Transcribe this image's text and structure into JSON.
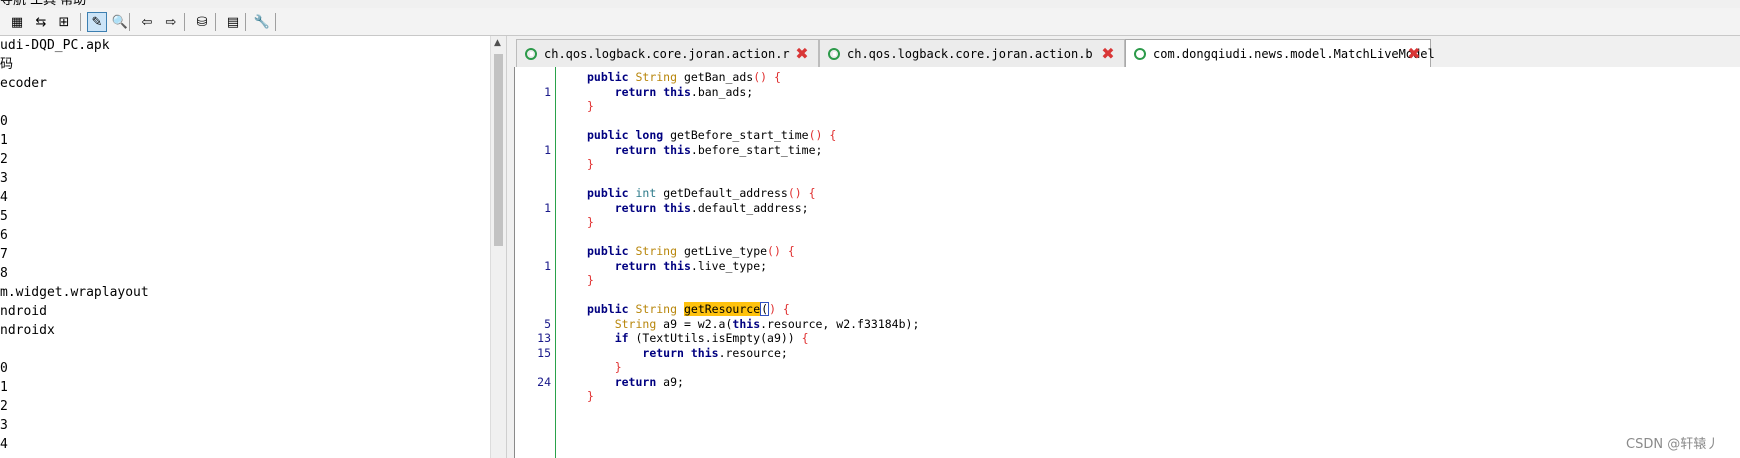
{
  "menubar": {
    "text": "导航 工具 帮助"
  },
  "toolbar": {
    "buttons": [
      {
        "name": "save-all",
        "glyph": "▦"
      },
      {
        "name": "sync-tree",
        "glyph": "⇆"
      },
      {
        "name": "flatten-packages",
        "glyph": "⊞"
      },
      {
        "name": "deobfuscation",
        "glyph": "✎"
      },
      {
        "name": "search",
        "glyph": "🔍"
      },
      {
        "name": "back",
        "glyph": "⇦"
      },
      {
        "name": "forward",
        "glyph": "⇨"
      },
      {
        "name": "decompile-all",
        "glyph": "⛁"
      },
      {
        "name": "log-viewer",
        "glyph": "▤"
      },
      {
        "name": "preferences",
        "glyph": "🔧"
      }
    ]
  },
  "tree": {
    "rows": [
      "udi-DQD_PC.apk",
      "码",
      "ecoder",
      "",
      "0",
      "1",
      "2",
      "3",
      "4",
      "5",
      "6",
      "7",
      "8",
      "m.widget.wraplayout",
      "ndroid",
      "ndroidx",
      "",
      "0",
      "1",
      "2",
      "3",
      "4"
    ]
  },
  "tabs": [
    {
      "label": "ch.qos.logback.core.joran.action.r",
      "active": false
    },
    {
      "label": "ch.qos.logback.core.joran.action.b",
      "active": false
    },
    {
      "label": "com.dongqiudi.news.model.MatchLiveModel",
      "active": true
    }
  ],
  "code": {
    "lines": [
      {
        "num": "",
        "tokens": [
          [
            "kw",
            "public"
          ],
          [
            "t",
            " "
          ],
          [
            "type",
            "String"
          ],
          [
            "t",
            " getBan_ads"
          ],
          [
            "br",
            "() {"
          ]
        ]
      },
      {
        "num": "1",
        "tokens": [
          [
            "t",
            "    "
          ],
          [
            "kw",
            "return"
          ],
          [
            "t",
            " "
          ],
          [
            "kw",
            "this"
          ],
          [
            "t",
            ".ban_ads;"
          ]
        ]
      },
      {
        "num": "",
        "tokens": [
          [
            "br",
            "}"
          ]
        ]
      },
      {
        "num": "",
        "tokens": []
      },
      {
        "num": "",
        "tokens": [
          [
            "kw",
            "public"
          ],
          [
            "t",
            " "
          ],
          [
            "kw",
            "long"
          ],
          [
            "t",
            " getBefore_start_time"
          ],
          [
            "br",
            "() {"
          ]
        ]
      },
      {
        "num": "1",
        "tokens": [
          [
            "t",
            "    "
          ],
          [
            "kw",
            "return"
          ],
          [
            "t",
            " "
          ],
          [
            "kw",
            "this"
          ],
          [
            "t",
            ".before_start_time;"
          ]
        ]
      },
      {
        "num": "",
        "tokens": [
          [
            "br",
            "}"
          ]
        ]
      },
      {
        "num": "",
        "tokens": []
      },
      {
        "num": "",
        "tokens": [
          [
            "kw",
            "public"
          ],
          [
            "t",
            " "
          ],
          [
            "ptype",
            "int"
          ],
          [
            "t",
            " getDefault_address"
          ],
          [
            "br",
            "() {"
          ]
        ]
      },
      {
        "num": "1",
        "tokens": [
          [
            "t",
            "    "
          ],
          [
            "kw",
            "return"
          ],
          [
            "t",
            " "
          ],
          [
            "kw",
            "this"
          ],
          [
            "t",
            ".default_address;"
          ]
        ]
      },
      {
        "num": "",
        "tokens": [
          [
            "br",
            "}"
          ]
        ]
      },
      {
        "num": "",
        "tokens": []
      },
      {
        "num": "",
        "tokens": [
          [
            "kw",
            "public"
          ],
          [
            "t",
            " "
          ],
          [
            "type",
            "String"
          ],
          [
            "t",
            " getLive_type"
          ],
          [
            "br",
            "() {"
          ]
        ]
      },
      {
        "num": "1",
        "tokens": [
          [
            "t",
            "    "
          ],
          [
            "kw",
            "return"
          ],
          [
            "t",
            " "
          ],
          [
            "kw",
            "this"
          ],
          [
            "t",
            ".live_type;"
          ]
        ]
      },
      {
        "num": "",
        "tokens": [
          [
            "br",
            "}"
          ]
        ]
      },
      {
        "num": "",
        "tokens": []
      },
      {
        "num": "",
        "tokens": [
          [
            "kw",
            "public"
          ],
          [
            "t",
            " "
          ],
          [
            "type",
            "String"
          ],
          [
            "t",
            " "
          ],
          [
            "hl",
            "getResource"
          ],
          [
            "caret",
            "("
          ],
          [
            "br",
            ") {"
          ]
        ]
      },
      {
        "num": "5",
        "tokens": [
          [
            "t",
            "    "
          ],
          [
            "type",
            "String"
          ],
          [
            "t",
            " a9 = w2.a("
          ],
          [
            "kw",
            "this"
          ],
          [
            "t",
            ".resource, w2.f33184b);"
          ]
        ]
      },
      {
        "num": "13",
        "tokens": [
          [
            "t",
            "    "
          ],
          [
            "kw",
            "if"
          ],
          [
            "t",
            " (TextUtils.isEmpty(a9)) "
          ],
          [
            "br",
            "{"
          ]
        ]
      },
      {
        "num": "15",
        "tokens": [
          [
            "t",
            "        "
          ],
          [
            "kw",
            "return"
          ],
          [
            "t",
            " "
          ],
          [
            "kw",
            "this"
          ],
          [
            "t",
            ".resource;"
          ]
        ]
      },
      {
        "num": "",
        "tokens": [
          [
            "t",
            "    "
          ],
          [
            "br",
            "}"
          ]
        ]
      },
      {
        "num": "24",
        "tokens": [
          [
            "t",
            "    "
          ],
          [
            "kw",
            "return"
          ],
          [
            "t",
            " a9;"
          ]
        ]
      },
      {
        "num": "",
        "tokens": [
          [
            "br",
            "}"
          ]
        ]
      }
    ]
  },
  "watermark": "CSDN @轩辕丿"
}
